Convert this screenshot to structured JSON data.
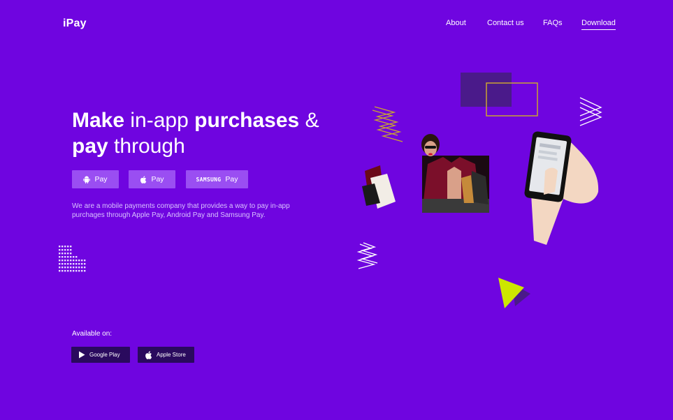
{
  "header": {
    "logo": "iPay",
    "nav": [
      {
        "label": "About"
      },
      {
        "label": "Contact us"
      },
      {
        "label": "FAQs"
      },
      {
        "label": "Download",
        "active": true
      }
    ]
  },
  "hero": {
    "title_parts": [
      "Make",
      "in-app",
      "purchases",
      "&",
      "pay",
      "through"
    ],
    "pay_buttons": [
      {
        "icon": "android-icon",
        "label": "Pay"
      },
      {
        "icon": "apple-icon",
        "label": "Pay"
      },
      {
        "brand": "SAMSUNG",
        "label": "Pay"
      }
    ],
    "description": "We are a mobile payments company that provides a way to pay in-app purchages through Apple Pay, Android Pay and Samsung Pay."
  },
  "availability": {
    "label": "Available on:",
    "stores": [
      {
        "icon": "play-icon",
        "label": "Google Play"
      },
      {
        "icon": "apple-icon",
        "label": "Apple Store"
      }
    ]
  },
  "colors": {
    "background": "#6f05e0",
    "button": "#9a4ef2",
    "store_button": "#2a0a5e",
    "accent_yellow": "#cde600",
    "accent_gold": "#c9a531",
    "dark_purple": "#4a1a8a"
  }
}
